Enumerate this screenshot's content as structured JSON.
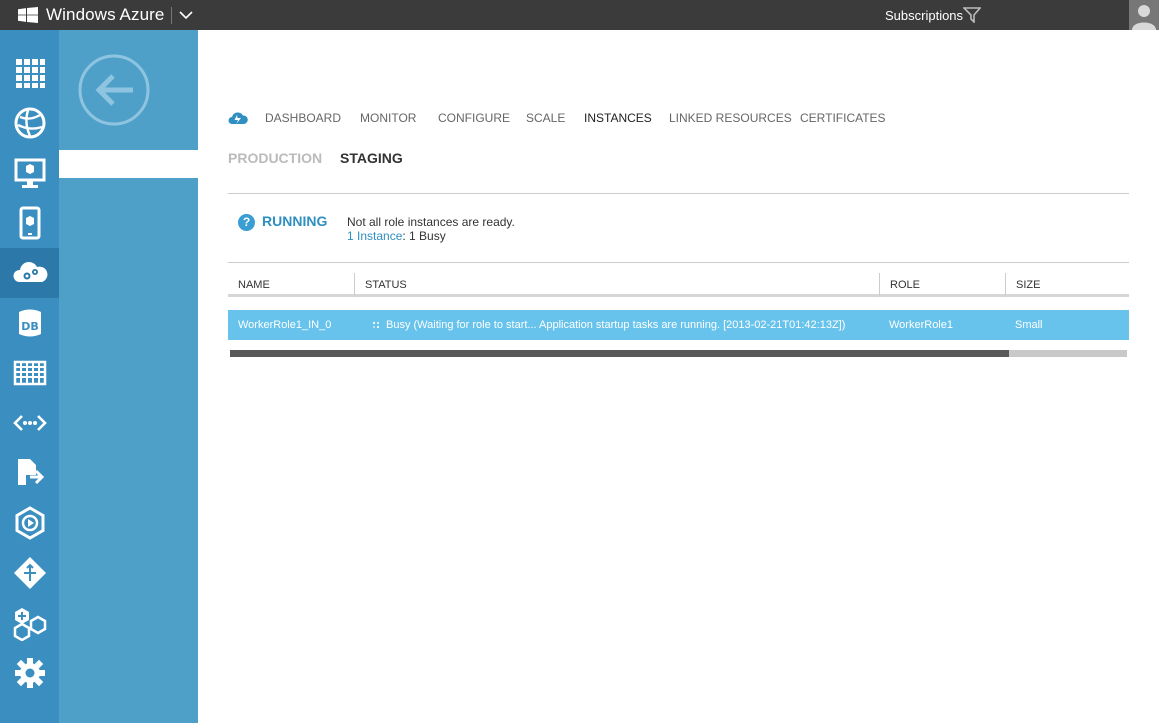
{
  "topbar": {
    "brand": "Windows Azure",
    "subscriptions_label": "Subscriptions"
  },
  "nav": {
    "items": [
      {
        "name": "all-items-icon"
      },
      {
        "name": "web-sites-icon"
      },
      {
        "name": "virtual-machines-icon"
      },
      {
        "name": "mobile-services-icon"
      },
      {
        "name": "cloud-services-icon",
        "active": true
      },
      {
        "name": "sql-databases-icon"
      },
      {
        "name": "storage-icon"
      },
      {
        "name": "service-bus-icon"
      },
      {
        "name": "import-export-icon"
      },
      {
        "name": "media-services-icon"
      },
      {
        "name": "networks-icon"
      },
      {
        "name": "add-ons-icon"
      },
      {
        "name": "settings-icon"
      }
    ]
  },
  "tabs": [
    "DASHBOARD",
    "MONITOR",
    "CONFIGURE",
    "SCALE",
    "INSTANCES",
    "LINKED RESOURCES",
    "CERTIFICATES"
  ],
  "active_tab": "INSTANCES",
  "subtabs": {
    "production": "PRODUCTION",
    "staging": "STAGING"
  },
  "status": {
    "word": "RUNNING",
    "message": "Not all role instances are ready.",
    "instances_link": "1 Instance",
    "instances_rest": ": 1 Busy"
  },
  "table": {
    "columns": [
      "NAME",
      "STATUS",
      "ROLE",
      "SIZE"
    ],
    "rows": [
      {
        "name": "WorkerRole1_IN_0",
        "status": "Busy (Waiting for role to start... Application startup tasks are running. [2013-02-21T01:42:13Z])",
        "role": "WorkerRole1",
        "size": "Small"
      }
    ]
  },
  "scrollbar": {
    "position_fraction": 0.87
  },
  "colors": {
    "topbar": "#3b3b3b",
    "nav": "#3a8ec0",
    "nav_active": "#2c79a9",
    "column": "#4fa0c9",
    "accent": "#2f8fc0",
    "selected_row": "#67c3ec"
  }
}
